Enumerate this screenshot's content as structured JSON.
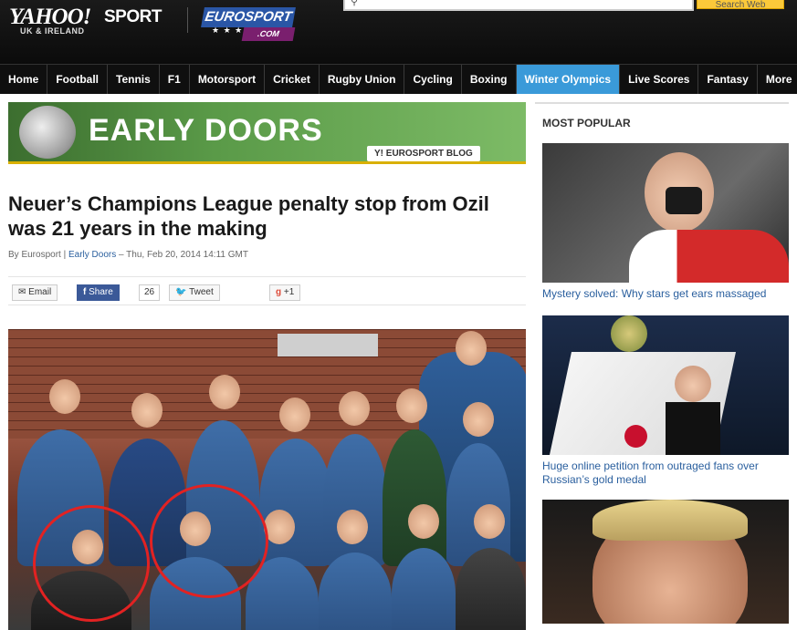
{
  "header": {
    "brand": "YAHOO!",
    "brand_section": "SPORT",
    "brand_region": "UK & IRELAND",
    "partner_logo": "EUROSPORT",
    "partner_domain": ".COM",
    "search_button": "Search Web"
  },
  "nav": {
    "items": [
      "Home",
      "Football",
      "Tennis",
      "F1",
      "Motorsport",
      "Cricket",
      "Rugby Union",
      "Cycling",
      "Boxing",
      "Winter Olympics",
      "Live Scores",
      "Fantasy",
      "More"
    ],
    "active": "Winter Olympics"
  },
  "banner": {
    "title": "EARLY DOORS",
    "tag": "EUROSPORT BLOG"
  },
  "article": {
    "headline": "Neuer’s Champions League penalty stop from Ozil was 21 years in the making",
    "byline_prefix": "By Eurosport |",
    "byline_blog": "Early Doors",
    "byline_date": "– Thu, Feb 20, 2014 14:11 GMT"
  },
  "share": {
    "email": "Email",
    "facebook": "Share",
    "facebook_count": "26",
    "tweet": "Tweet",
    "gplus": "+1"
  },
  "sidebar": {
    "title": "MOST POPULAR",
    "items": [
      {
        "title": "Mystery solved: Why stars get ears massaged"
      },
      {
        "title": "Huge online petition from outraged fans over Russian’s gold medal"
      }
    ]
  },
  "colors": {
    "nav_active": "#3a9ad9",
    "link": "#2a5f9e",
    "header_bg": "#111111"
  }
}
